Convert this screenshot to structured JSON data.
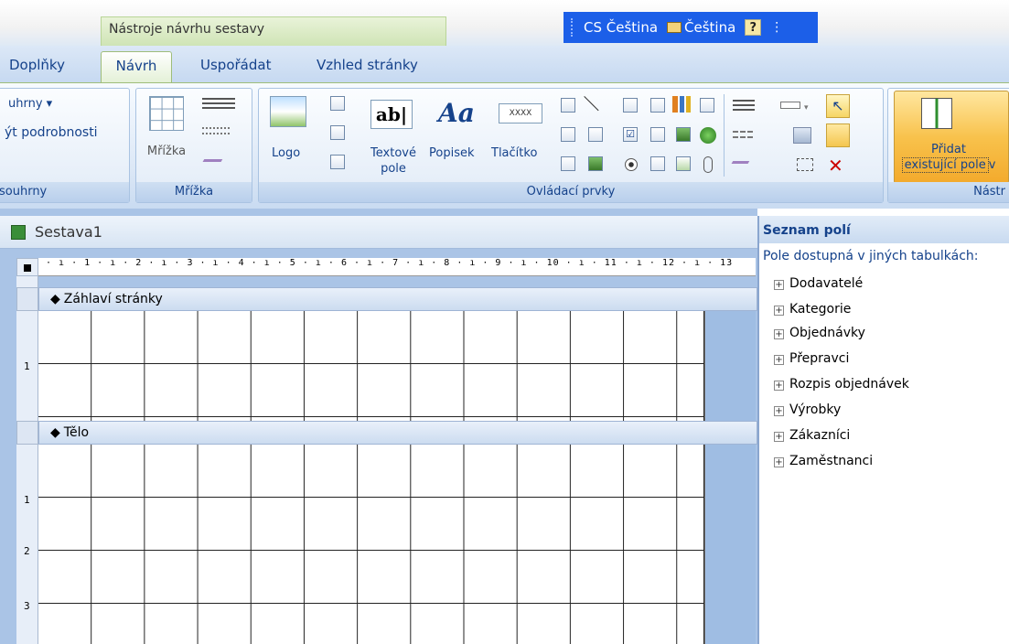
{
  "context_tab": "Nástroje návrhu sestavy",
  "langbar": {
    "lang_code": "CS Čeština",
    "keyboard": "Čeština",
    "help": "?",
    "options": "⋮"
  },
  "tabs": [
    "Doplňky",
    "Návrh",
    "Uspořádat",
    "Vzhled stránky"
  ],
  "ribbon": {
    "group1": {
      "label": "souhrny",
      "items": [
        "uhrny ▾",
        "ýt podrobnosti"
      ]
    },
    "group2": {
      "label": "Mřížka",
      "button": "Mřížka"
    },
    "group3": {
      "label": "Ovládací prvky",
      "logo": "Logo",
      "textbox_l1": "Textové",
      "textbox_l2": "pole",
      "label_btn": "Popisek",
      "button_btn": "Tlačítko",
      "textbox_icon": "ab|",
      "label_icon": "Aa",
      "button_icon": "XXXX"
    },
    "group4": {
      "label": "Nástr",
      "add_l1": "Přidat",
      "add_l2": "existující pole",
      "add_cut": "v"
    }
  },
  "document": {
    "title": "Sestava1",
    "ruler": "· ı · 1 · ı · 2 · ı · 3 · ı · 4 · ı · 5 · ı · 6 · ı · 7 · ı · 8 · ı · 9 · ı · 10 · ı · 11 · ı · 12 · ı · 13",
    "sections": [
      "Záhlaví stránky",
      "Tělo"
    ],
    "vruler_ticks": [
      "1",
      "1",
      "2",
      "3"
    ]
  },
  "field_list": {
    "title": "Seznam polí",
    "subtitle": "Pole dostupná v jiných tabulkách:",
    "items": [
      "Dodavatelé",
      "Kategorie",
      "Objednávky",
      "Přepravci",
      "Rozpis objednávek",
      "Výrobky",
      "Zákazníci",
      "Zaměstnanci"
    ]
  }
}
